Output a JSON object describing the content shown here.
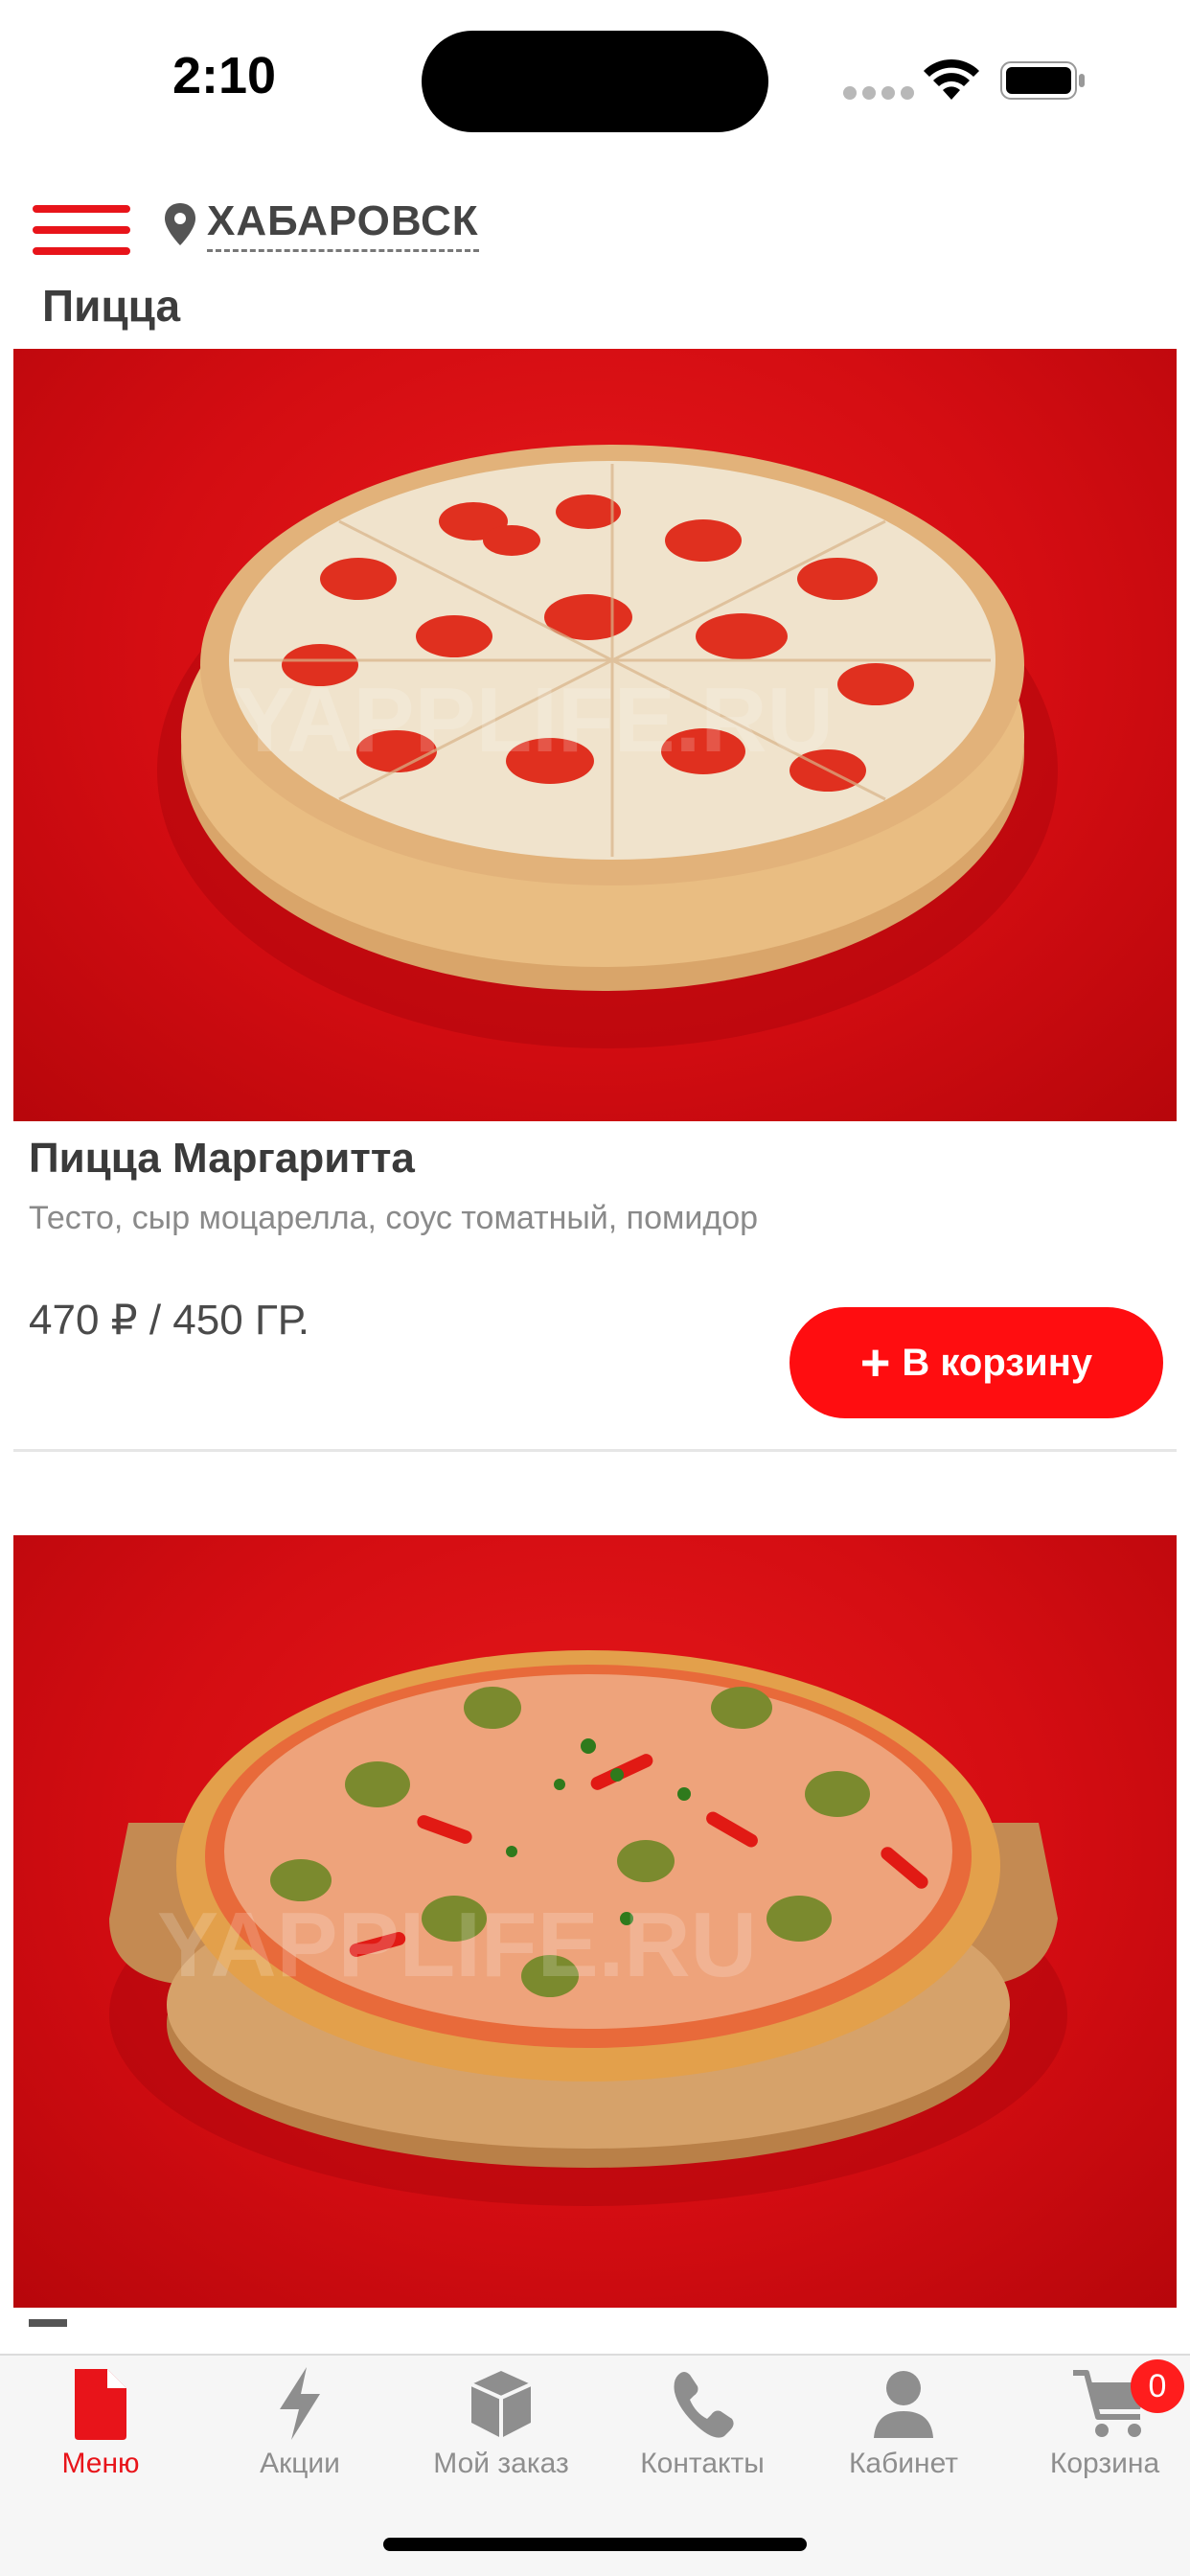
{
  "status_bar": {
    "time": "2:10"
  },
  "header": {
    "city": "ХАБАРОВСК"
  },
  "section": {
    "title": "Пицца"
  },
  "products": [
    {
      "name": "Пицца Маргаритта",
      "description": "Тесто, сыр моцарелла, соус томатный, помидор",
      "price": "470 ₽ / 450 ГР.",
      "cart_label": "В корзину",
      "watermark": "YAPPLIFE.RU"
    },
    {
      "name": "",
      "watermark": "YAPPLIFE.RU"
    }
  ],
  "tabbar": {
    "items": [
      {
        "label": "Меню",
        "icon": "document-icon",
        "active": true
      },
      {
        "label": "Акции",
        "icon": "lightning-icon"
      },
      {
        "label": "Мой заказ",
        "icon": "box-icon"
      },
      {
        "label": "Контакты",
        "icon": "phone-icon"
      },
      {
        "label": "Кабинет",
        "icon": "user-icon"
      },
      {
        "label": "Корзина",
        "icon": "cart-icon"
      }
    ],
    "cart_badge": "0"
  },
  "colors": {
    "accent": "#e8141a",
    "button": "#ff0d10",
    "photo_background": "#d40d12"
  }
}
